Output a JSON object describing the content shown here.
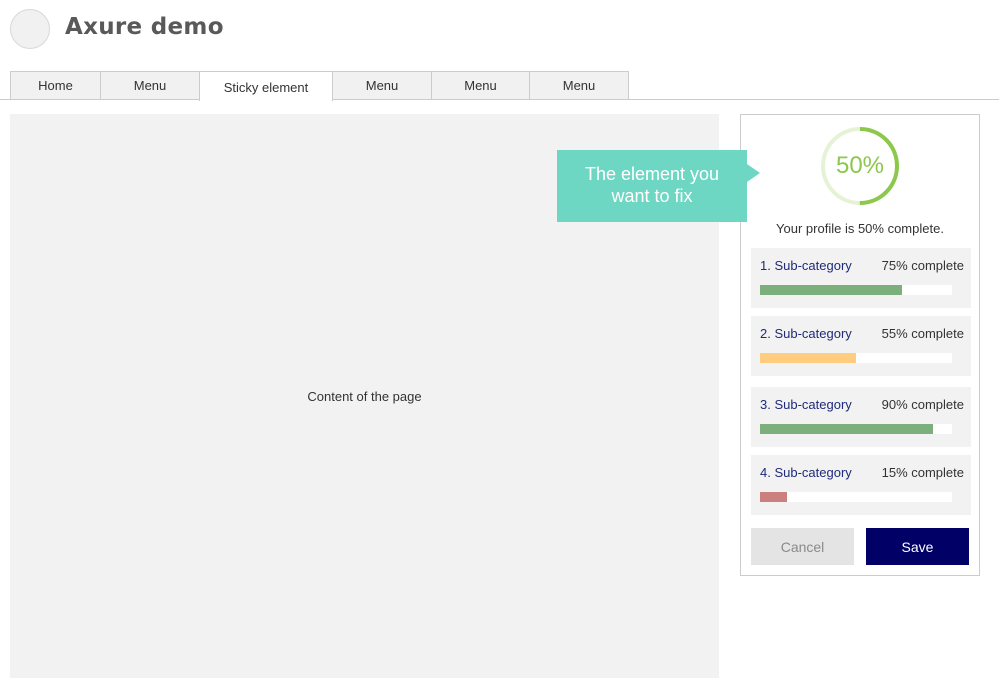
{
  "app": {
    "title": "Axure demo"
  },
  "nav": {
    "tabs": [
      {
        "label": "Home"
      },
      {
        "label": "Menu"
      },
      {
        "label": "Sticky element",
        "active": true
      },
      {
        "label": "Menu"
      },
      {
        "label": "Menu"
      },
      {
        "label": "Menu"
      }
    ]
  },
  "main": {
    "content_label": "Content of the page"
  },
  "callout": {
    "text_line1": "The element you",
    "text_line2": "want to fix",
    "color": "#6ed7c4"
  },
  "profile": {
    "progress_label": "50%",
    "progress_value": 0.5,
    "progress_color": "#8cc84b",
    "summary": "Your profile is 50% complete.",
    "subcategories": [
      {
        "label": "1. Sub-category",
        "pct_text": "75% complete",
        "value": 0.74,
        "color": "#7daf7d"
      },
      {
        "label": "2. Sub-category",
        "pct_text": "55% complete",
        "value": 0.5,
        "color": "#ffcc80"
      },
      {
        "label": "3. Sub-category",
        "pct_text": "90% complete",
        "value": 0.9,
        "color": "#7daf7d"
      },
      {
        "label": "4. Sub-category",
        "pct_text": "15% complete",
        "value": 0.14,
        "color": "#cc7f7f"
      }
    ],
    "cancel_label": "Cancel",
    "save_label": "Save"
  }
}
